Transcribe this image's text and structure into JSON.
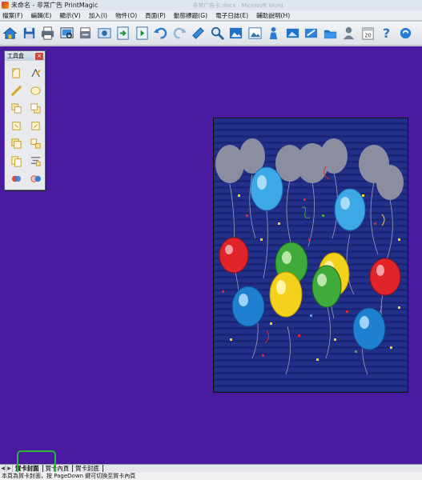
{
  "window": {
    "title": "未命名 - 非常广告 PrintMagic",
    "ghost_title": "非常广告卡.docx - Microsoft Word"
  },
  "menu": [
    {
      "label": "檔案(F)"
    },
    {
      "label": "編輯(E)"
    },
    {
      "label": "顯示(V)"
    },
    {
      "label": "加入(I)"
    },
    {
      "label": "物件(O)"
    },
    {
      "label": "頁面(P)"
    },
    {
      "label": "動態標題(G)"
    },
    {
      "label": "電子日誌(E)"
    },
    {
      "label": "輔助說明(H)"
    }
  ],
  "toolbar": {
    "buttons": [
      {
        "icon": "home-icon"
      },
      {
        "icon": "save-icon"
      },
      {
        "icon": "print-icon"
      },
      {
        "icon": "print-preview-icon"
      },
      {
        "icon": "printer-setup-icon"
      },
      {
        "icon": "card-preview-icon"
      },
      {
        "icon": "import-icon"
      },
      {
        "icon": "export-icon"
      },
      {
        "icon": "undo-icon"
      },
      {
        "icon": "redo-icon"
      },
      {
        "icon": "layers-icon"
      },
      {
        "icon": "zoom-icon"
      },
      {
        "icon": "image-icon"
      },
      {
        "icon": "picture-icon"
      },
      {
        "icon": "clipart-icon"
      },
      {
        "icon": "photo-icon"
      },
      {
        "icon": "photo-edit-icon"
      },
      {
        "icon": "folder-icon"
      },
      {
        "icon": "person-icon"
      },
      {
        "icon": "calendar-icon"
      },
      {
        "icon": "help-icon"
      },
      {
        "icon": "link-icon"
      }
    ],
    "calendar_label": "20"
  },
  "toolbox": {
    "title": "工具盒",
    "close_label": "×",
    "tools": [
      {
        "icon": "select-icon"
      },
      {
        "icon": "rotate-icon"
      },
      {
        "icon": "line-icon"
      },
      {
        "icon": "ellipse-icon"
      },
      {
        "icon": "bring-front-icon"
      },
      {
        "icon": "send-back-icon"
      },
      {
        "icon": "forward-icon"
      },
      {
        "icon": "backward-icon"
      },
      {
        "icon": "group-icon"
      },
      {
        "icon": "ungroup-icon"
      },
      {
        "icon": "copy-icon"
      },
      {
        "icon": "align-icon"
      },
      {
        "icon": "color-icon"
      },
      {
        "icon": "effect-icon"
      }
    ]
  },
  "card": {
    "name": "balloon-card"
  },
  "tabs": [
    {
      "label": "賀卡封面",
      "active": true
    },
    {
      "label": "賀卡內頁",
      "active": false
    },
    {
      "label": "賀卡封底",
      "active": false
    }
  ],
  "tab_nav": {
    "prev": "◀",
    "next": "▶"
  },
  "status": {
    "text": "本頁為賀卡封面，按 PageDown 鍵可切換至賀卡內頁"
  },
  "colors": {
    "workspace": "#4a1aa0",
    "card": "#22308a",
    "highlight": "#28b83a"
  }
}
